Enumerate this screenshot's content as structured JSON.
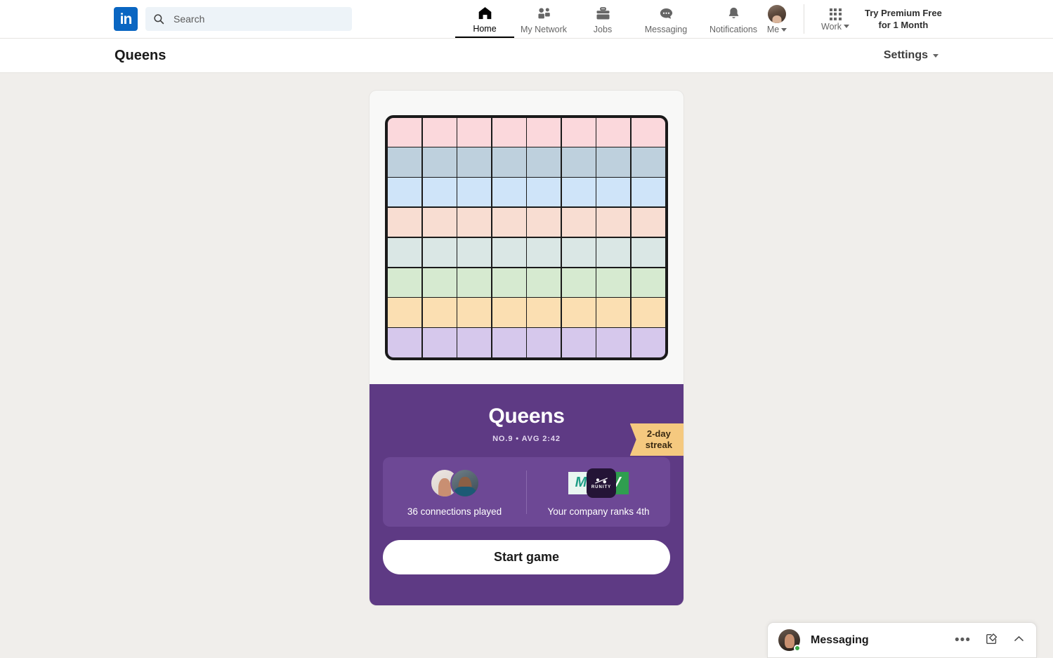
{
  "colors": {
    "page_background": "#f0eeeb",
    "brand_blue": "#0a66c2",
    "card_purple": "#5e3a84",
    "stats_purple": "#6d4895",
    "streak_tan": "#f5c97f",
    "online_green": "#39a845"
  },
  "globalnav": {
    "logo_text": "in",
    "logo_name": "linkedin-logo",
    "search": {
      "placeholder": "Search",
      "value": "",
      "icon": "search-icon"
    },
    "items": [
      {
        "label": "Home",
        "icon": "home-icon",
        "active": true
      },
      {
        "label": "My Network",
        "icon": "people-icon",
        "active": false
      },
      {
        "label": "Jobs",
        "icon": "briefcase-icon",
        "active": false
      },
      {
        "label": "Messaging",
        "icon": "chat-bubble-icon",
        "active": false
      },
      {
        "label": "Notifications",
        "icon": "bell-icon",
        "active": false
      }
    ],
    "me": {
      "label": "Me",
      "icon": "avatar",
      "caret": "chevron-down-icon"
    },
    "work": {
      "label": "Work",
      "icon": "app-grid-icon",
      "caret": "chevron-down-icon"
    },
    "premium": {
      "line1": "Try Premium Free",
      "line2": "for 1 Month"
    }
  },
  "subheader": {
    "title": "Queens",
    "settings_label": "Settings",
    "settings_caret": "chevron-down-icon"
  },
  "game": {
    "board": {
      "columns": 8,
      "rows": 8,
      "row_colors": [
        "#fbd8dc",
        "#bed0dd",
        "#cfe4f9",
        "#f8ddd2",
        "#dae7e5",
        "#d6ead0",
        "#fbdfb2",
        "#d6c8ec"
      ]
    },
    "title": "Queens",
    "subtitle": "NO.9  •  AVG 2:42",
    "streak": {
      "line1": "2-day",
      "line2": "streak"
    },
    "stats": [
      {
        "label": "36 connections played",
        "icon": "connection-avatars"
      },
      {
        "label": "Your company ranks 4th",
        "icon": "company-logos"
      }
    ],
    "company_logos": {
      "left_letter": "M",
      "center_name": "RUNITY",
      "right_letter": "V"
    },
    "start_button": "Start game"
  },
  "messaging_widget": {
    "title": "Messaging",
    "avatar_icon": "avatar",
    "status_icon": "online-dot",
    "actions": [
      {
        "name": "more-options-icon",
        "glyph": "•••"
      },
      {
        "name": "compose-icon",
        "glyph": "compose"
      },
      {
        "name": "chevron-up-icon",
        "glyph": "chevron-up"
      }
    ]
  }
}
